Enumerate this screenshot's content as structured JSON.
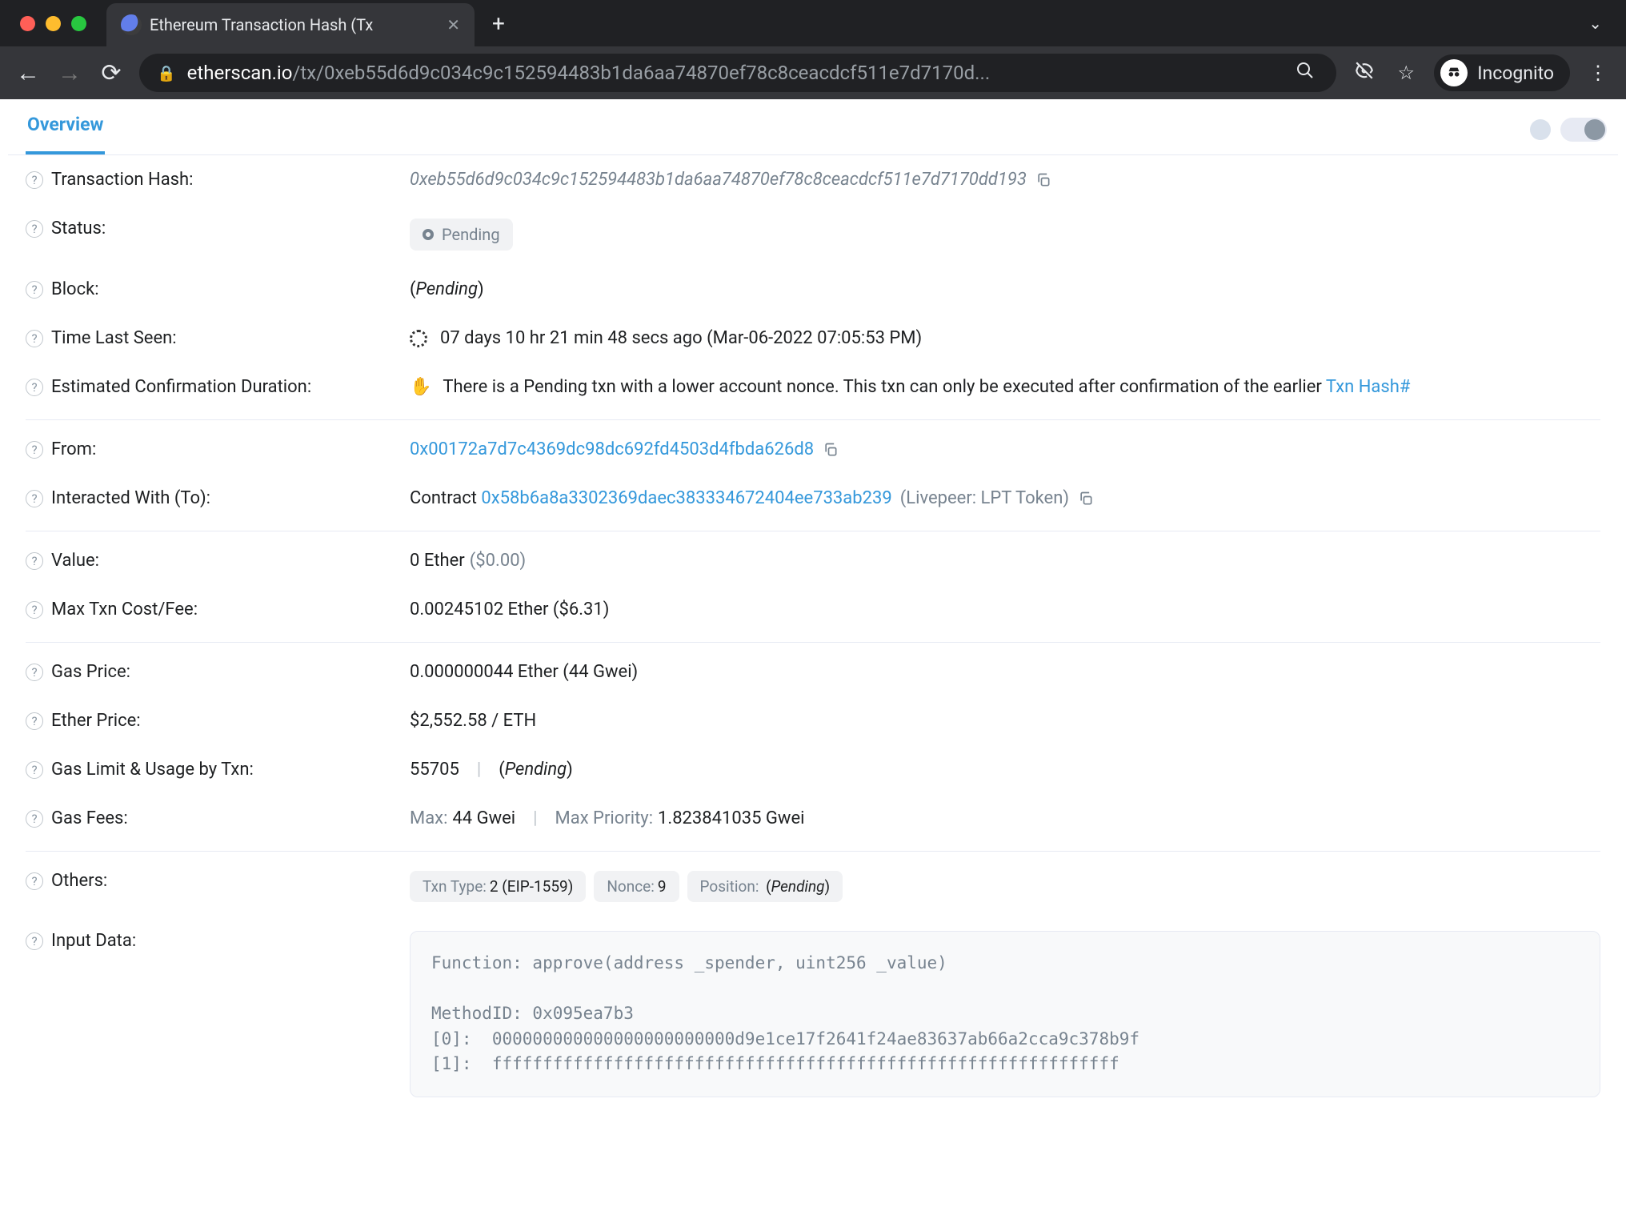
{
  "browser": {
    "tab_title": "Ethereum Transaction Hash (Tx",
    "url_domain": "etherscan.io",
    "url_path": "/tx/0xeb55d6d9c034c9c152594483b1da6aa74870ef78c8ceacdcf511e7d7170d...",
    "incognito_label": "Incognito"
  },
  "page": {
    "active_tab": "Overview",
    "fields": {
      "txhash": {
        "label": "Transaction Hash:",
        "value": "0xeb55d6d9c034c9c152594483b1da6aa74870ef78c8ceacdcf511e7d7170dd193"
      },
      "status": {
        "label": "Status:",
        "value": "Pending"
      },
      "block": {
        "label": "Block:",
        "value": "Pending"
      },
      "time": {
        "label": "Time Last Seen:",
        "value": "07 days 10 hr 21 min 48 secs ago (Mar-06-2022 07:05:53 PM)"
      },
      "est": {
        "label": "Estimated Confirmation Duration:",
        "text": "There is a Pending txn with a lower account nonce. This txn can only be executed after confirmation of the earlier ",
        "link": "Txn Hash#"
      },
      "from": {
        "label": "From:",
        "value": "0x00172a7d7c4369dc98dc692fd4503d4fbda626d8"
      },
      "to": {
        "label": "Interacted With (To):",
        "prefix": "Contract ",
        "addr": "0x58b6a8a3302369daec383334672404ee733ab239",
        "suffix": "(Livepeer: LPT Token)"
      },
      "value": {
        "label": "Value:",
        "value": "0 Ether",
        "usd": "($0.00)"
      },
      "fee": {
        "label": "Max Txn Cost/Fee:",
        "value": "0.00245102 Ether ($6.31)"
      },
      "gasprice": {
        "label": "Gas Price:",
        "value": "0.000000044 Ether (44 Gwei)"
      },
      "ethprice": {
        "label": "Ether Price:",
        "value": "$2,552.58 / ETH"
      },
      "gaslimit": {
        "label": "Gas Limit & Usage by Txn:",
        "limit": "55705",
        "usage": "Pending"
      },
      "gasfees": {
        "label": "Gas Fees:",
        "max_label": "Max:",
        "max_val": "44 Gwei",
        "prio_label": "Max Priority:",
        "prio_val": "1.823841035 Gwei"
      },
      "others": {
        "label": "Others:",
        "type_label": "Txn Type:",
        "type_val": "2 (EIP-1559)",
        "nonce_label": "Nonce:",
        "nonce_val": "9",
        "pos_label": "Position:",
        "pos_val": "Pending"
      },
      "input": {
        "label": "Input Data:",
        "code": "Function: approve(address _spender, uint256 _value)\n\nMethodID: 0x095ea7b3\n[0]:  000000000000000000000000d9e1ce17f2641f24ae83637ab66a2cca9c378b9f\n[1]:  ffffffffffffffffffffffffffffffffffffffffffffffffffffffffffffff"
      }
    }
  }
}
